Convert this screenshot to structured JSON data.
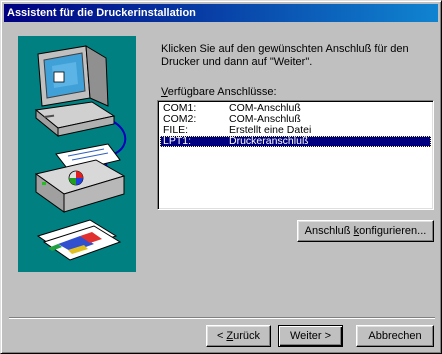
{
  "window": {
    "title": "Assistent für die Druckerinstallation"
  },
  "instruction": "Klicken Sie auf den gewünschten Anschluß für den\nDrucker und dann auf \"Weiter\".",
  "ports_label": {
    "accel": "V",
    "rest": "erfügbare Anschlüsse:"
  },
  "ports": [
    {
      "port": "COM1:",
      "description": "COM-Anschluß"
    },
    {
      "port": "COM2:",
      "description": "COM-Anschluß"
    },
    {
      "port": "FILE:",
      "description": "Erstellt eine Datei"
    },
    {
      "port": "LPT1:",
      "description": "Druckeranschluß"
    }
  ],
  "selected_port": "LPT1:",
  "configure_button": {
    "pre": "Anschluß ",
    "accel": "k",
    "rest": "onfigurieren..."
  },
  "buttons": {
    "back": {
      "pre": "< ",
      "accel": "Z",
      "rest": "urück"
    },
    "next": "Weiter >",
    "cancel": "Abbrechen"
  },
  "colors": {
    "title_start": "#000080",
    "title_end": "#1084d0",
    "art_bg": "#008080",
    "selection": "#000080"
  },
  "icons": [
    "computer-icon",
    "printer-icon",
    "printed-pages-icon"
  ]
}
